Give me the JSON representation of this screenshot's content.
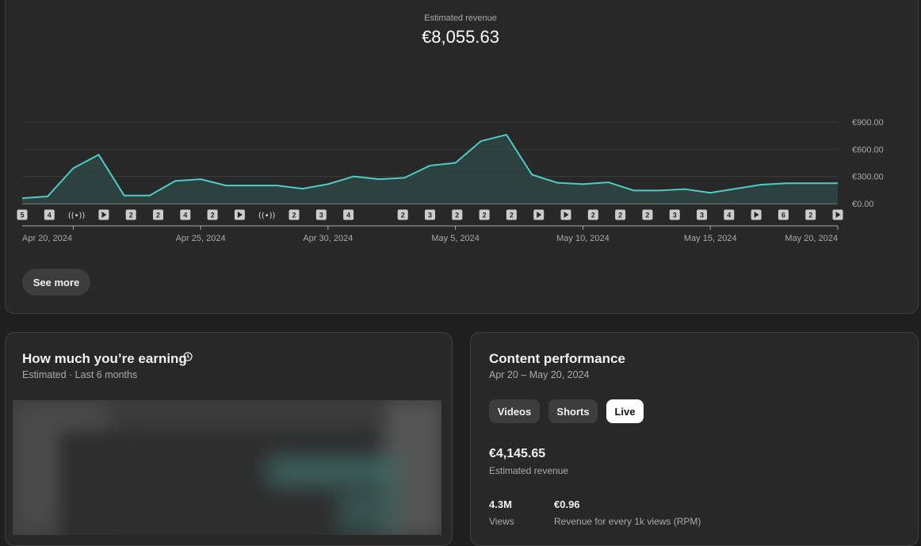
{
  "revenue": {
    "label": "Estimated revenue",
    "total": "€8,055.63",
    "see_more": "See more"
  },
  "chart_data": {
    "type": "area",
    "x": [
      "2024-04-18",
      "2024-04-19",
      "2024-04-20",
      "2024-04-21",
      "2024-04-22",
      "2024-04-23",
      "2024-04-24",
      "2024-04-25",
      "2024-04-26",
      "2024-04-27",
      "2024-04-28",
      "2024-04-29",
      "2024-04-30",
      "2024-05-01",
      "2024-05-02",
      "2024-05-03",
      "2024-05-04",
      "2024-05-05",
      "2024-05-06",
      "2024-05-07",
      "2024-05-08",
      "2024-05-09",
      "2024-05-10",
      "2024-05-11",
      "2024-05-12",
      "2024-05-13",
      "2024-05-14",
      "2024-05-15",
      "2024-05-16",
      "2024-05-17",
      "2024-05-18",
      "2024-05-19",
      "2024-05-20"
    ],
    "values": [
      60,
      80,
      390,
      540,
      90,
      90,
      250,
      270,
      200,
      200,
      200,
      165,
      215,
      300,
      270,
      285,
      420,
      450,
      690,
      760,
      320,
      230,
      215,
      235,
      145,
      145,
      160,
      120,
      165,
      210,
      225,
      225,
      225
    ],
    "ylim": [
      0,
      900
    ],
    "yticks": [
      "€900.00",
      "€600.00",
      "€300.00",
      "€0.00"
    ],
    "xticks": [
      "Apr 20, 2024",
      "Apr 25, 2024",
      "Apr 30, 2024",
      "May 5, 2024",
      "May 10, 2024",
      "May 15, 2024",
      "May 20, 2024"
    ],
    "grid": true,
    "line_color": "#4ecdc4"
  },
  "markers": [
    "5",
    "4",
    "live",
    "play",
    "2",
    "2",
    "4",
    "2",
    "play",
    "live",
    "2",
    "3",
    "4",
    "",
    "2",
    "3",
    "2",
    "2",
    "2",
    "play",
    "play",
    "2",
    "2",
    "2",
    "3",
    "3",
    "4",
    "play",
    "6",
    "2",
    "play"
  ],
  "earning": {
    "title": "How much you’re earning",
    "subtitle": "Estimated · Last 6 months",
    "icon": "clock-icon"
  },
  "performance": {
    "title": "Content performance",
    "date_range": "Apr 20 – May 20, 2024",
    "tabs": [
      "Videos",
      "Shorts",
      "Live"
    ],
    "active_tab": "Live",
    "revenue_value": "€4,145.65",
    "revenue_label": "Estimated revenue",
    "views_value": "4.3M",
    "views_label": "Views",
    "rpm_value": "€0.96",
    "rpm_label": "Revenue for every 1k views (RPM)"
  }
}
